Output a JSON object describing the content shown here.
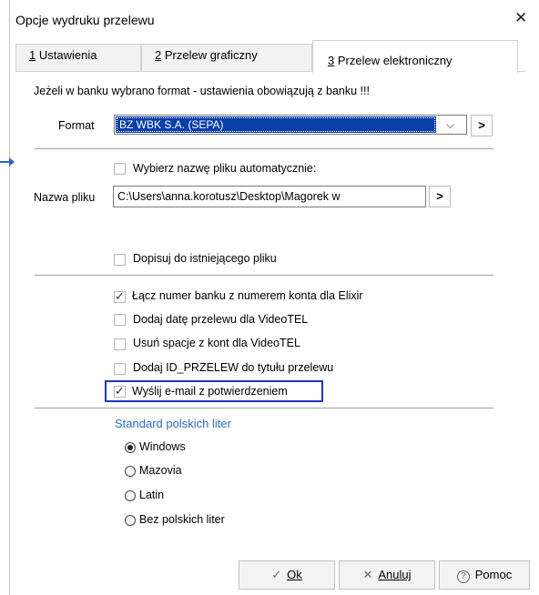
{
  "window": {
    "title": "Opcje wydruku przelewu",
    "close_glyph": "✕"
  },
  "tabs": [
    {
      "key": "1",
      "label": " Ustawienia",
      "active": false
    },
    {
      "key": "2",
      "label": " Przelew graficzny",
      "active": false
    },
    {
      "key": "3",
      "label": " Przelew elektroniczny",
      "active": true
    }
  ],
  "info_text": "Jeżeli w banku wybrano format - ustawienia obowiązują z banku !!!",
  "format": {
    "label": "Format",
    "value": "BZ WBK S.A. (SEPA)",
    "nav_glyph": ">"
  },
  "auto_name": {
    "label": "Wybierz nazwę pliku automatycznie:",
    "checked": false
  },
  "file": {
    "label": "Nazwa pliku",
    "value": "C:\\Users\\anna.korotusz\\Desktop\\Magorek w",
    "nav_glyph": ">"
  },
  "append": {
    "label": "Dopisuj do istniejącego pliku",
    "checked": false
  },
  "options": [
    {
      "label": "Łącz numer banku z numerem konta dla Elixir",
      "checked": true
    },
    {
      "label": "Dodaj datę przelewu dla VideoTEL",
      "checked": false
    },
    {
      "label": "Usuń spacje z kont dla VideoTEL",
      "checked": false
    },
    {
      "label": "Dodaj ID_PRZELEW do tytułu przelewu",
      "checked": false
    },
    {
      "label": "Wyślij e-mail z potwierdzeniem",
      "checked": true
    }
  ],
  "charset": {
    "title": "Standard polskich liter",
    "items": [
      {
        "label": "Windows",
        "selected": true
      },
      {
        "label": "Mazovia",
        "selected": false
      },
      {
        "label": "Latin",
        "selected": false
      },
      {
        "label": "Bez polskich liter",
        "selected": false
      }
    ]
  },
  "buttons": {
    "ok": {
      "icon": "✓",
      "label": "Ok"
    },
    "cancel": {
      "icon": "✕",
      "label": "Anuluj"
    },
    "help": {
      "icon": "?",
      "label": "Pomoc"
    }
  },
  "colors": {
    "accent": "#2f6bc4",
    "selection": "#0a3fa8",
    "highlight": "#1c36c8"
  }
}
